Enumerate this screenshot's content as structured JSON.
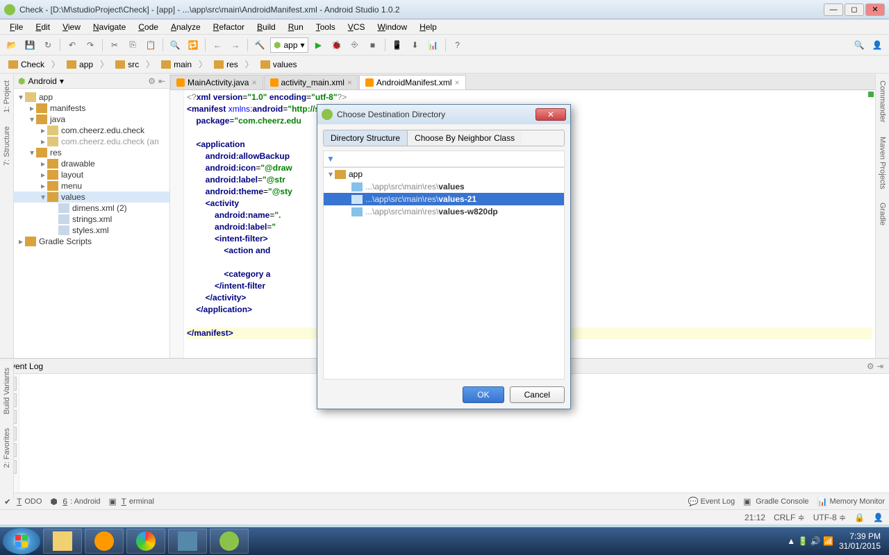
{
  "window": {
    "title": "Check - [D:\\M\\studioProject\\Check] - [app] - ...\\app\\src\\main\\AndroidManifest.xml - Android Studio 1.0.2"
  },
  "menu": [
    "File",
    "Edit",
    "View",
    "Navigate",
    "Code",
    "Analyze",
    "Refactor",
    "Build",
    "Run",
    "Tools",
    "VCS",
    "Window",
    "Help"
  ],
  "breadcrumb": [
    "Check",
    "app",
    "src",
    "main",
    "res",
    "values"
  ],
  "projectHeader": "Android",
  "tree": [
    {
      "indent": 0,
      "toggle": "▾",
      "iconCls": "pkg",
      "label": "app",
      "selected": false
    },
    {
      "indent": 1,
      "toggle": "▸",
      "iconCls": "folder",
      "label": "manifests"
    },
    {
      "indent": 1,
      "toggle": "▾",
      "iconCls": "folder",
      "label": "java"
    },
    {
      "indent": 2,
      "toggle": "▸",
      "iconCls": "pkg",
      "label": "com.cheerz.edu.check"
    },
    {
      "indent": 2,
      "toggle": "▸",
      "iconCls": "pkg",
      "label": "com.cheerz.edu.check (an",
      "dim": true
    },
    {
      "indent": 1,
      "toggle": "▾",
      "iconCls": "folder",
      "label": "res"
    },
    {
      "indent": 2,
      "toggle": "▸",
      "iconCls": "folder",
      "label": "drawable"
    },
    {
      "indent": 2,
      "toggle": "▸",
      "iconCls": "folder",
      "label": "layout"
    },
    {
      "indent": 2,
      "toggle": "▸",
      "iconCls": "folder",
      "label": "menu"
    },
    {
      "indent": 2,
      "toggle": "▾",
      "iconCls": "folder",
      "label": "values",
      "selected": true
    },
    {
      "indent": 3,
      "toggle": "",
      "iconCls": "file",
      "label": "dimens.xml (2)"
    },
    {
      "indent": 3,
      "toggle": "",
      "iconCls": "file",
      "label": "strings.xml"
    },
    {
      "indent": 3,
      "toggle": "",
      "iconCls": "file",
      "label": "styles.xml"
    },
    {
      "indent": 0,
      "toggle": "▸",
      "iconCls": "folder",
      "label": "Gradle Scripts"
    }
  ],
  "editorTabs": [
    {
      "label": "MainActivity.java",
      "active": false
    },
    {
      "label": "activity_main.xml",
      "active": false
    },
    {
      "label": "AndroidManifest.xml",
      "active": true
    }
  ],
  "code": [
    {
      "html": "<span class='kw-gray'>&lt;?</span><span class='kw-navy'>xml version</span>=<span class='kw-str'>\"1.0\"</span> <span class='kw-navy'>encoding</span>=<span class='kw-str'>\"utf-8\"</span><span class='kw-gray'>?&gt;</span>"
    },
    {
      "html": "<span class='kw-navy'>&lt;manifest</span> <span class='kw-blue'>xmlns:</span><span class='kw-navy'>android</span>=<span class='kw-str'>\"http://schemas.android.com/apk/res/android\"</span>"
    },
    {
      "html": "    <span class='kw-navy'>package</span>=<span class='kw-str'>\"com.cheerz.edu</span>"
    },
    {
      "html": ""
    },
    {
      "html": "    <span class='kw-navy'>&lt;application</span>"
    },
    {
      "html": "        <span class='kw-navy'>android:allowBackup</span>"
    },
    {
      "html": "        <span class='kw-navy'>android:icon</span>=<span class='kw-str'>\"@draw</span>"
    },
    {
      "html": "        <span class='kw-navy'>android:label</span>=<span class='kw-str'>\"@str</span>"
    },
    {
      "html": "        <span class='kw-navy'>android:theme</span>=<span class='kw-str'>\"@sty</span>"
    },
    {
      "html": "        <span class='kw-navy'>&lt;activity</span>"
    },
    {
      "html": "            <span class='kw-navy'>android:name</span>=<span class='kw-str'>\".</span>"
    },
    {
      "html": "            <span class='kw-navy'>android:label</span>=<span class='kw-str'>\"</span>"
    },
    {
      "html": "            <span class='kw-navy'>&lt;intent-filter&gt;</span>"
    },
    {
      "html": "                <span class='kw-navy'>&lt;action</span> <span class='kw-navy'>and</span>"
    },
    {
      "html": ""
    },
    {
      "html": "                <span class='kw-navy'>&lt;category</span> <span class='kw-navy'>a</span>"
    },
    {
      "html": "            <span class='kw-navy'>&lt;/intent-filter</span>"
    },
    {
      "html": "        <span class='kw-navy'>&lt;/activity&gt;</span>"
    },
    {
      "html": "    <span class='kw-navy'>&lt;/application&gt;</span>"
    },
    {
      "html": ""
    },
    {
      "hl": true,
      "html": "<span class='kw-navy'>&lt;/manifest&gt;</span>"
    }
  ],
  "dialog": {
    "title": "Choose Destination Directory",
    "tabs": [
      "Directory Structure",
      "Choose By Neighbor Class"
    ],
    "activeTab": 0,
    "root": "app",
    "items": [
      {
        "path": "...\\app\\src\\main\\res\\",
        "name": "values",
        "selected": false
      },
      {
        "path": "...\\app\\src\\main\\res\\",
        "name": "values-21",
        "selected": true
      },
      {
        "path": "...\\app\\src\\main\\res\\",
        "name": "values-w820dp",
        "selected": false
      }
    ],
    "ok": "OK",
    "cancel": "Cancel"
  },
  "eventLog": {
    "title": "Event Log"
  },
  "bottomBar": {
    "left": [
      "TODO",
      "6: Android",
      "Terminal"
    ],
    "right": [
      "Event Log",
      "Gradle Console",
      "Memory Monitor"
    ]
  },
  "statusbar": {
    "line": "21:12",
    "lineEnding": "CRLF",
    "encoding": "UTF-8"
  },
  "leftRail": [
    "1: Project",
    "7: Structure"
  ],
  "leftRail2": [
    "Build Variants",
    "2: Favorites"
  ],
  "rightRail": [
    "Commander",
    "Maven Projects",
    "Gradle"
  ],
  "tray": {
    "time": "7:39 PM",
    "date": "31/01/2015"
  },
  "runCombo": "app"
}
